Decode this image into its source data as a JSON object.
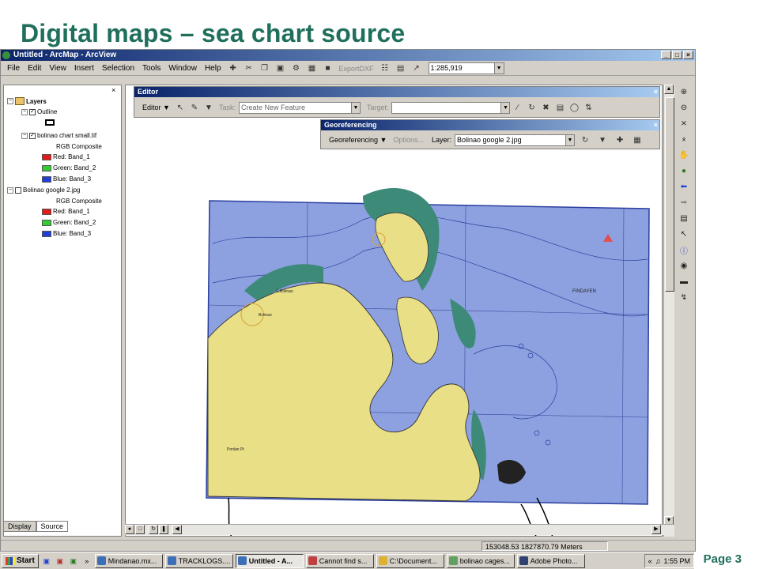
{
  "slide": {
    "title": "Digital maps – sea chart source",
    "page_label": "Page 3"
  },
  "window": {
    "title": "Untitled - ArcMap - ArcView",
    "buttons": [
      "_",
      "□",
      "×"
    ]
  },
  "menubar": {
    "items": [
      "File",
      "Edit",
      "View",
      "Insert",
      "Selection",
      "Tools",
      "Window",
      "Help"
    ],
    "export_label": "ExportDXF",
    "scale_value": "1:285,919"
  },
  "toc": {
    "close": "×",
    "root": "Layers",
    "layers": [
      {
        "name": "Outline",
        "checked": true
      },
      {
        "name": "bolinao chart small.tif",
        "checked": true,
        "composite": "RGB Composite",
        "bands": [
          {
            "label": "Red:  Band_1",
            "color": "#e31a1c"
          },
          {
            "label": "Green: Band_2",
            "color": "#33cc33"
          },
          {
            "label": "Blue:  Band_3",
            "color": "#1f3fd6"
          }
        ]
      },
      {
        "name": "Bolinao google 2.jpg",
        "checked": false,
        "composite": "RGB Composite",
        "bands": [
          {
            "label": "Red:  Band_1",
            "color": "#e31a1c"
          },
          {
            "label": "Green: Band_2",
            "color": "#33cc33"
          },
          {
            "label": "Blue:  Band_3",
            "color": "#1f3fd6"
          }
        ]
      }
    ],
    "tabs": [
      "Display",
      "Source"
    ]
  },
  "editor": {
    "caption": "Editor",
    "close": "×",
    "menu_label": "Editor",
    "task_label": "Task:",
    "task_value": "Create New Feature",
    "target_label": "Target:"
  },
  "georef": {
    "caption": "Georeferencing",
    "close": "×",
    "menu_label": "Georeferencing",
    "options_label": "Options...",
    "layer_label": "Layer:",
    "layer_value": "Bolinao google 2.jpg"
  },
  "map": {
    "labels": [
      "FINDAYEN",
      "Bolinao",
      "C.Bolinao",
      "Ponlan Pt"
    ],
    "colors": {
      "sea": "#8da0e0",
      "land": "#e8df86",
      "reef": "#3d8a78",
      "frame": "#2b3f9e"
    }
  },
  "status": {
    "coords": "153048.53  1827870.79 Meters"
  },
  "taskbar": {
    "start": "Start",
    "tasks": [
      "Mindanao.mx...",
      "TRACKLOGS....",
      "Untitled - A...",
      "Cannot find s...",
      "C:\\Document...",
      "bolinao cages...",
      "Adobe Photo..."
    ],
    "active_index": 2,
    "clock": "1:55 PM"
  }
}
